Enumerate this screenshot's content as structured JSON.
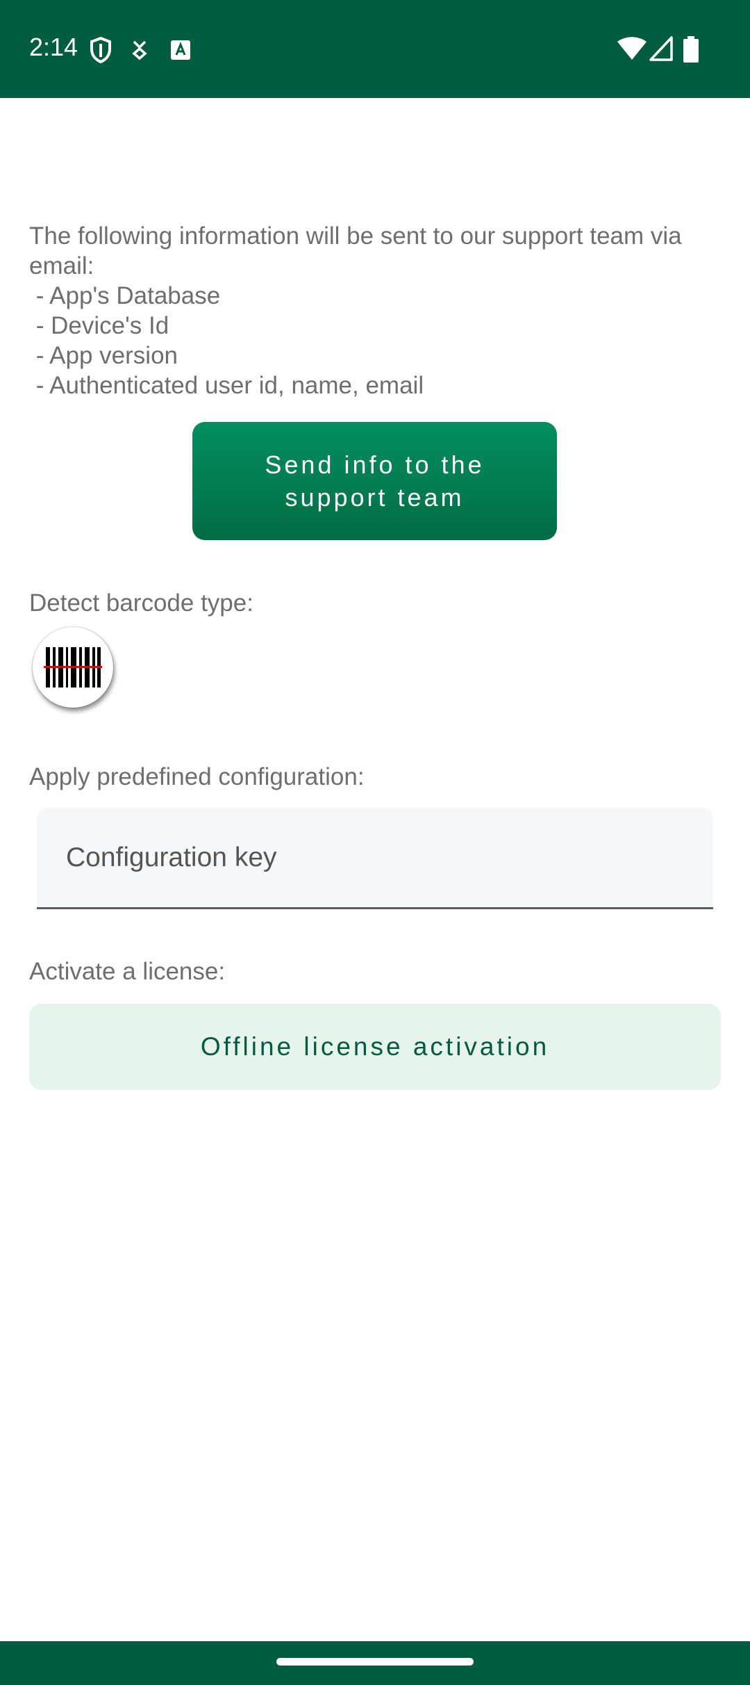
{
  "status_bar": {
    "time": "2:14",
    "left_icons": [
      "shield-icon",
      "fiber-manager-icon",
      "a-notification-icon"
    ],
    "right_icons": [
      "wifi-icon",
      "cell-signal-icon",
      "battery-icon"
    ],
    "background": "#025c3f"
  },
  "support": {
    "info_text": "The following information will be sent to our support team via email:\n - App's Database\n - Device's Id\n - App version\n - Authenticated user id, name, email",
    "send_button_label": "Send info to the support team"
  },
  "barcode": {
    "label": "Detect barcode type:",
    "icon": "barcode-scan-icon"
  },
  "config": {
    "label": "Apply predefined configuration:",
    "value": "",
    "placeholder": "Configuration key"
  },
  "license": {
    "label": "Activate a license:",
    "offline_button_label": "Offline license activation"
  },
  "colors": {
    "brand_dark": "#025c3f",
    "button_green": "#028f5f",
    "light_green_bg": "#e5f4ec",
    "label_gray": "#6e6e6e"
  }
}
